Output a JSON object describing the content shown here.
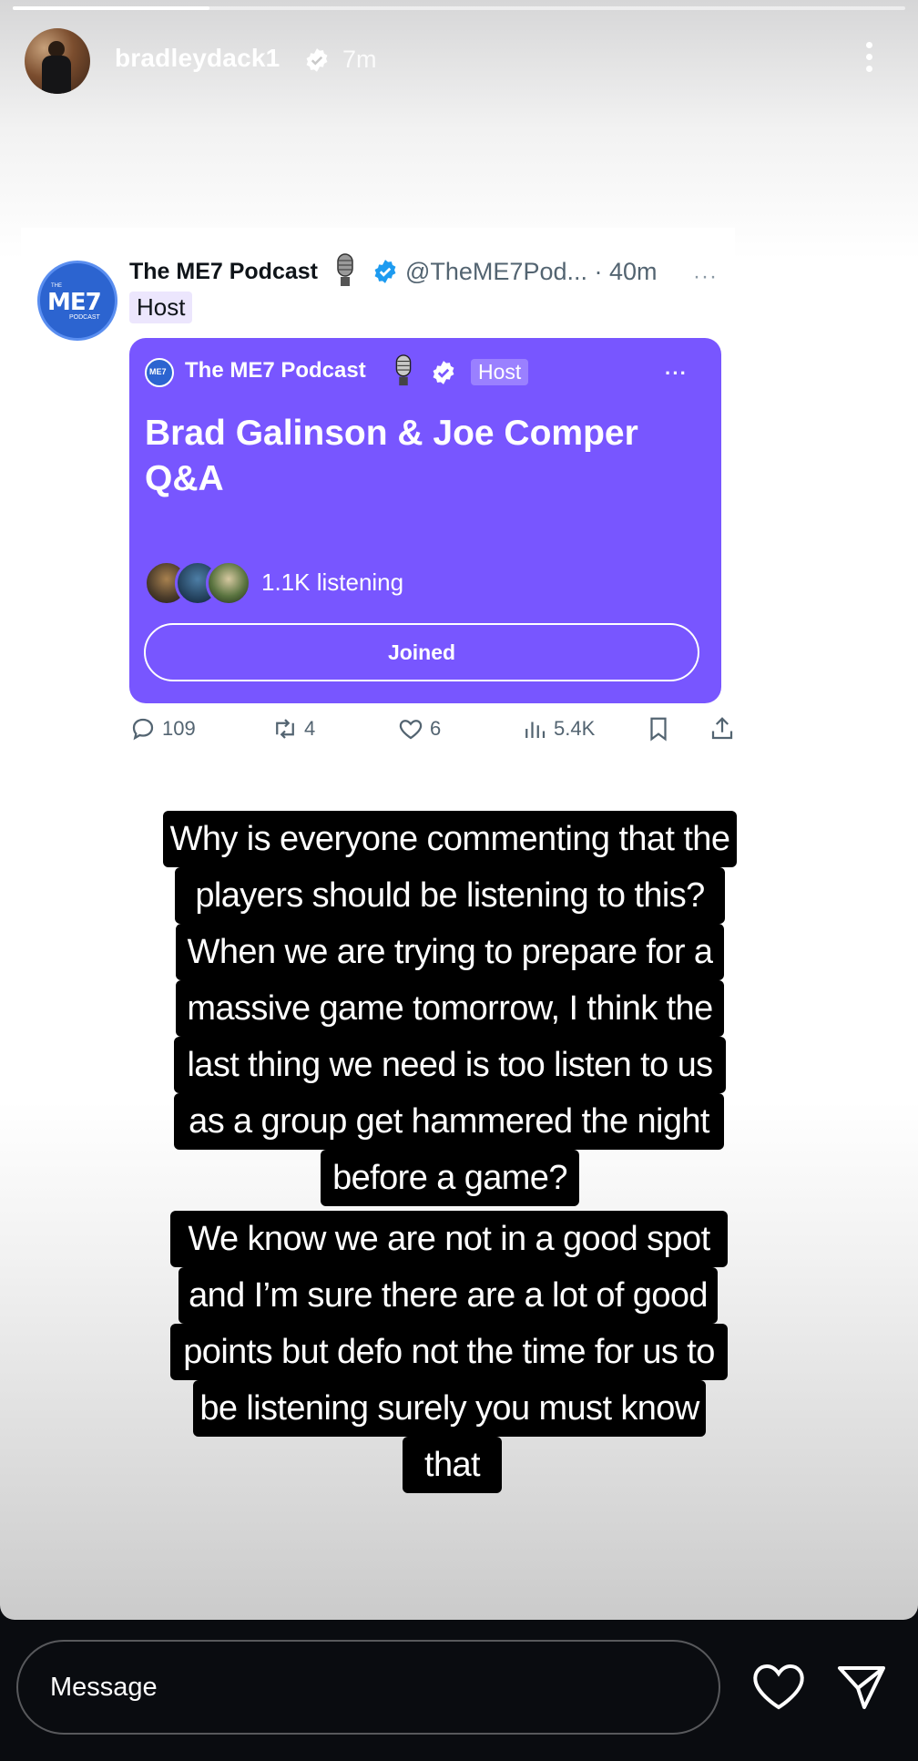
{
  "story": {
    "progress": 0.22,
    "username": "bradleydack1",
    "time_ago": "7m",
    "icons": {
      "verified": "verified-badge-icon",
      "more": "more-vertical-icon"
    }
  },
  "tweet": {
    "name": "The ME7 Podcast",
    "handle_time": "@TheME7Pod... · 40m",
    "more": "···",
    "host_label": "Host",
    "avatar_logo": "ME7",
    "avatar_logo_top": "THE",
    "avatar_logo_bottom": "PODCAST",
    "space": {
      "host_name": "The ME7 Podcast",
      "host_label": "Host",
      "more": "···",
      "mini_logo": "ME7",
      "title": "Brad Galinson & Joe Comper Q&A",
      "listening": "1.1K listening",
      "button_label": "Joined"
    },
    "actions": {
      "replies": "109",
      "reposts": "4",
      "likes": "6",
      "views": "5.4K"
    }
  },
  "caption": {
    "lines": [
      "Why is everyone commenting that the",
      "players should be listening to this?",
      "When we are trying to prepare for a",
      "massive game tomorrow, I think the",
      "last thing we need is too listen to us",
      "as a group get hammered the night",
      "before a game?",
      "We know we are not in a good spot",
      "and I’m sure there are a lot of good",
      "points but defo not the time for us to",
      "be listening surely you must know",
      "that"
    ]
  },
  "reply_bar": {
    "placeholder": "Message"
  },
  "colors": {
    "space_purple": "#7856ff",
    "twitter_blue": "#1d9bf0",
    "bottom_bar": "#0a0c10"
  }
}
